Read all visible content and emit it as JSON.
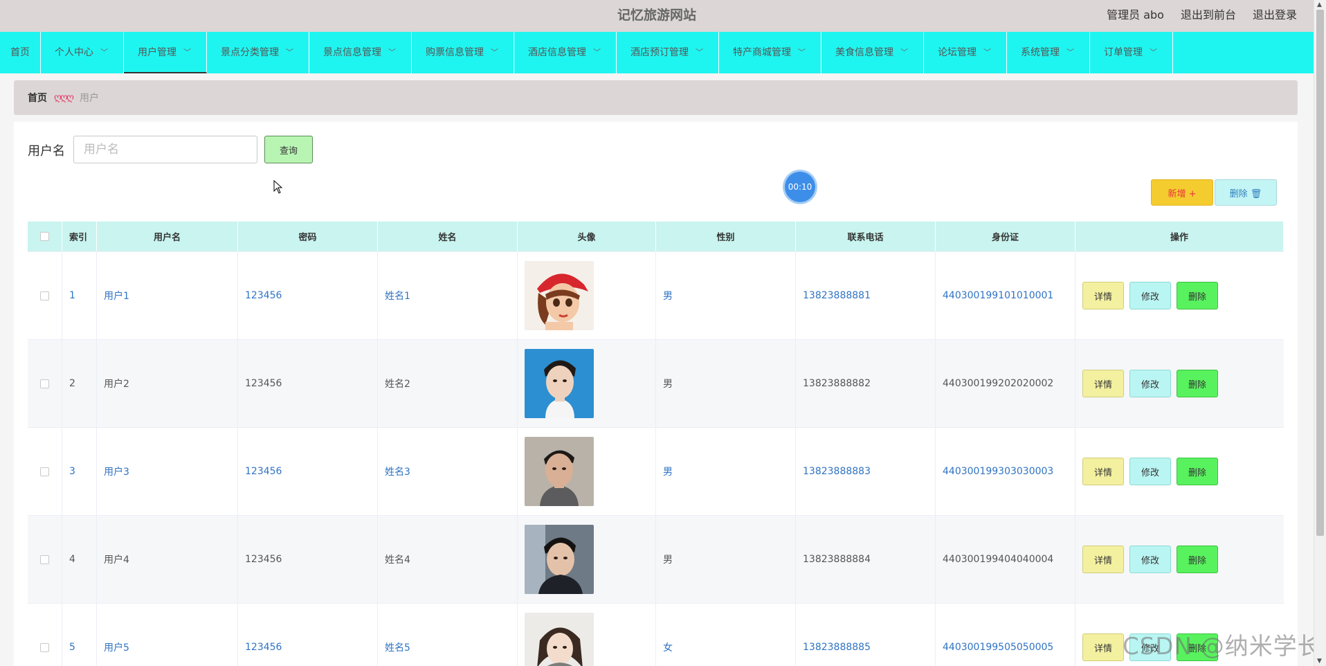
{
  "header": {
    "site_title": "记忆旅游网站",
    "admin_label": "管理员 abo",
    "back_to_front": "退出到前台",
    "logout": "退出登录"
  },
  "nav": [
    {
      "label": "首页",
      "has_dropdown": false
    },
    {
      "label": "个人中心",
      "has_dropdown": true
    },
    {
      "label": "用户管理",
      "has_dropdown": true,
      "active": true
    },
    {
      "label": "景点分类管理",
      "has_dropdown": true
    },
    {
      "label": "景点信息管理",
      "has_dropdown": true
    },
    {
      "label": "购票信息管理",
      "has_dropdown": true
    },
    {
      "label": "酒店信息管理",
      "has_dropdown": true
    },
    {
      "label": "酒店预订管理",
      "has_dropdown": true
    },
    {
      "label": "特产商城管理",
      "has_dropdown": true
    },
    {
      "label": "美食信息管理",
      "has_dropdown": true
    },
    {
      "label": "论坛管理",
      "has_dropdown": true
    },
    {
      "label": "系统管理",
      "has_dropdown": true
    },
    {
      "label": "订单管理",
      "has_dropdown": true
    }
  ],
  "breadcrumb": {
    "home": "首页",
    "separator": "ღღღ",
    "current": "用户"
  },
  "search": {
    "label": "用户名",
    "placeholder": "用户名",
    "value": "",
    "button": "查询"
  },
  "timer": "00:10",
  "toolbar": {
    "add_label": "新增 +",
    "delete_label": "删除 🗑"
  },
  "table": {
    "headers": [
      "索引",
      "用户名",
      "密码",
      "姓名",
      "头像",
      "性别",
      "联系电话",
      "身份证",
      "操作"
    ],
    "rows": [
      {
        "index": "1",
        "username": "用户1",
        "password": "123456",
        "name": "姓名1",
        "gender": "男",
        "phone": "13823888881",
        "id_card": "440300199101010001",
        "avatar_icon": "avatar-cartoon-girl-red-hat"
      },
      {
        "index": "2",
        "username": "用户2",
        "password": "123456",
        "name": "姓名2",
        "gender": "男",
        "phone": "13823888882",
        "id_card": "440300199202020002",
        "avatar_icon": "avatar-man-blue-bg"
      },
      {
        "index": "3",
        "username": "用户3",
        "password": "123456",
        "name": "姓名3",
        "gender": "男",
        "phone": "13823888883",
        "id_card": "440300199303030003",
        "avatar_icon": "avatar-man-grey-shirt"
      },
      {
        "index": "4",
        "username": "用户4",
        "password": "123456",
        "name": "姓名4",
        "gender": "男",
        "phone": "13823888884",
        "id_card": "440300199404040004",
        "avatar_icon": "avatar-man-dark-jacket"
      },
      {
        "index": "5",
        "username": "用户5",
        "password": "123456",
        "name": "姓名5",
        "gender": "女",
        "phone": "13823888885",
        "id_card": "440300199505050005",
        "avatar_icon": "avatar-woman-grey-sweater"
      }
    ],
    "row_actions": {
      "detail": "详情",
      "edit": "修改",
      "delete": "删除"
    }
  },
  "watermark": "CSDN @纳米学长",
  "colors": {
    "topbar": "#dcd6d6",
    "nav": "#1ff5f0",
    "table_header": "#c9f4ef",
    "link_blue": "#2f73c3",
    "add_button": "#f5cc2f",
    "delete_button": "#58f25e"
  }
}
